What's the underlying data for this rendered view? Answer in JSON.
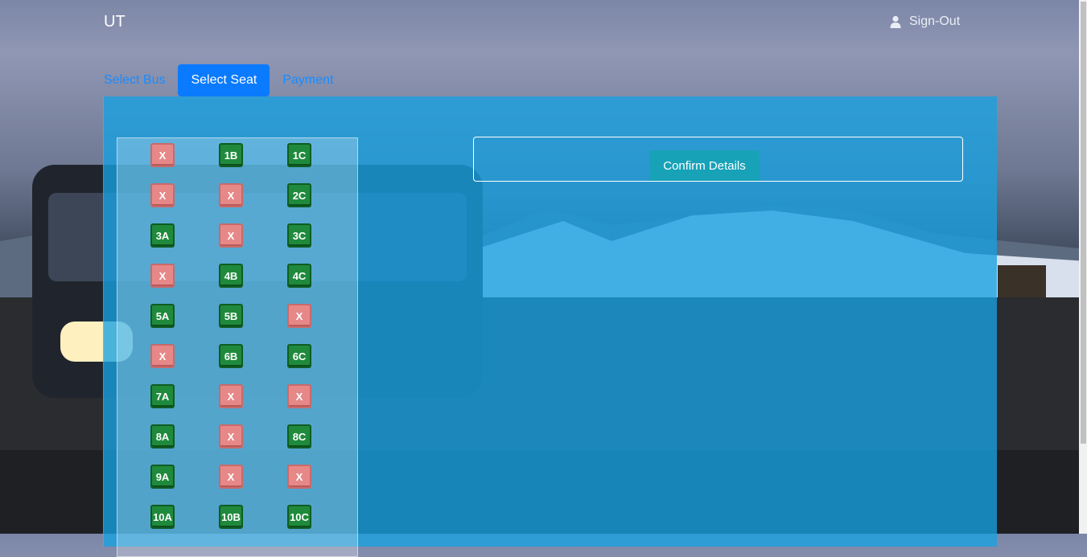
{
  "nav": {
    "brand": "UT",
    "signout_label": "Sign-Out",
    "user_icon": "user-icon"
  },
  "tabs": [
    {
      "label": "Select Bus",
      "active": false
    },
    {
      "label": "Select Seat",
      "active": true
    },
    {
      "label": "Payment",
      "active": false
    }
  ],
  "seats": [
    [
      "X",
      "1B",
      "1C"
    ],
    [
      "X",
      "X",
      "2C"
    ],
    [
      "3A",
      "X",
      "3C"
    ],
    [
      "X",
      "4B",
      "4C"
    ],
    [
      "5A",
      "5B",
      "X"
    ],
    [
      "X",
      "6B",
      "6C"
    ],
    [
      "7A",
      "X",
      "X"
    ],
    [
      "8A",
      "X",
      "8C"
    ],
    [
      "9A",
      "X",
      "X"
    ],
    [
      "10A",
      "10B",
      "10C"
    ]
  ],
  "confirm": {
    "label": "Confirm Details"
  },
  "colors": {
    "available_seat": "#1f8a3c",
    "booked_seat": "#e68888",
    "panel": "#17a2e1",
    "active_tab": "#0a7bff",
    "confirm_button": "#17a2b8"
  }
}
